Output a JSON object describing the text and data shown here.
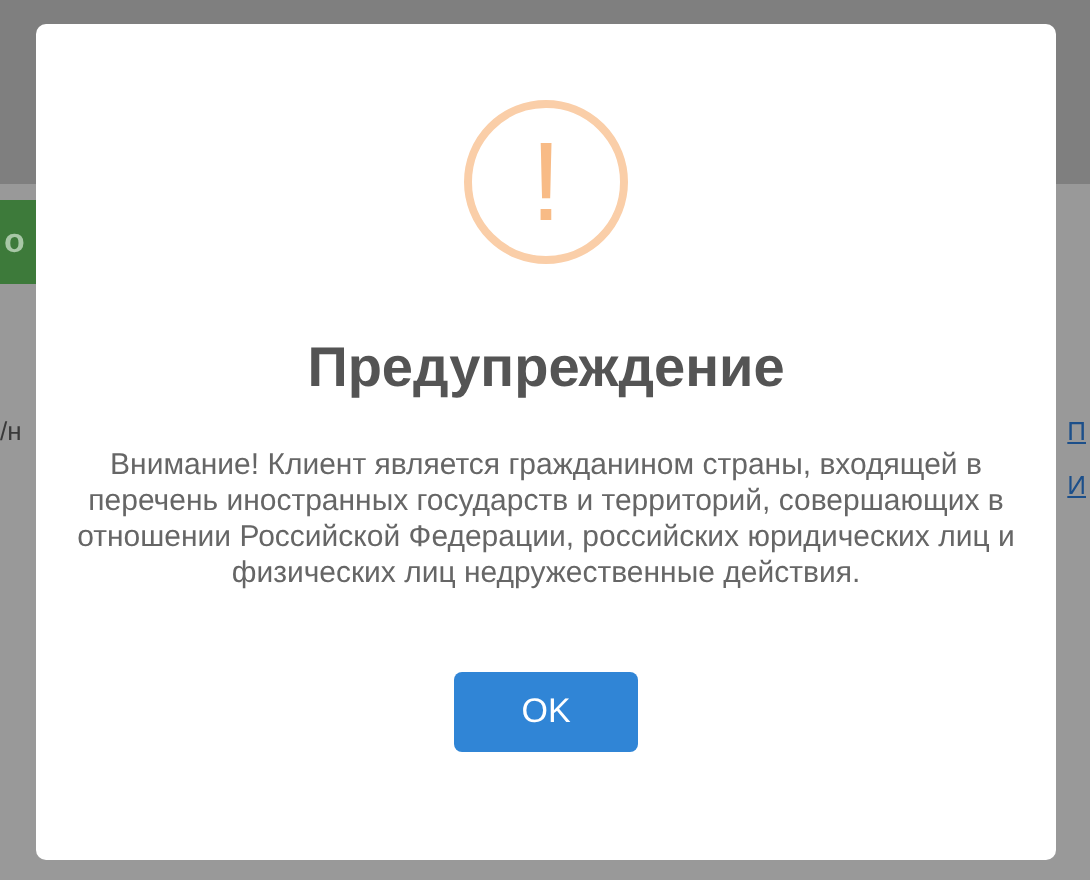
{
  "background": {
    "button_label": "о",
    "left_text": "/н",
    "links": [
      "П",
      "И"
    ]
  },
  "dialog": {
    "kind": "warning",
    "icon": "!",
    "title": "Предупреждение",
    "message": "Внимание! Клиент является гражданином страны, входящей в перечень иностранных государств и территорий, совершающих в отношении Российской Федерации, российских юридических лиц и физических лиц недружественные действия.",
    "buttons": [
      "OK"
    ]
  }
}
